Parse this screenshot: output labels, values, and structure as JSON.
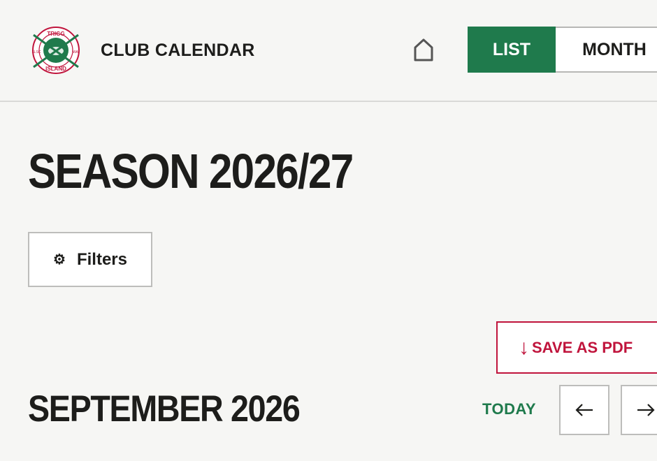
{
  "header": {
    "title": "CLUB CALENDAR",
    "logo": {
      "top_text": "TRIGG",
      "bottom_text": "ISLAND",
      "left_text": "SLSC",
      "right_text": "WA"
    },
    "home_icon": "home-icon",
    "view_toggle": {
      "list_label": "LIST",
      "month_label": "MONTH",
      "selected": "LIST"
    }
  },
  "page": {
    "season_title": "SEASON 2026/27",
    "filters_label": "Filters",
    "filters_icon": "gear-icon",
    "save_pdf_label": "SAVE AS PDF",
    "save_pdf_icon": "download-arrow-icon",
    "month_title": "SEPTEMBER 2026",
    "today_label": "TODAY",
    "prev_icon": "arrow-left-icon",
    "next_icon": "arrow-right-icon"
  },
  "colors": {
    "brand_green": "#1f7a4c",
    "brand_red": "#c0143c",
    "background": "#f6f6f4",
    "text": "#1d1d1b"
  }
}
